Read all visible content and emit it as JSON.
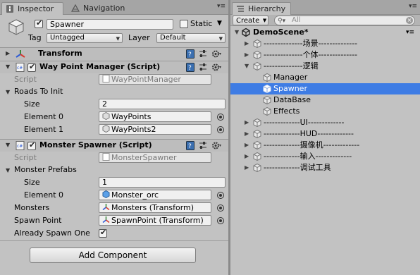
{
  "inspector": {
    "tab_label": "Inspector",
    "nav_tab_label": "Navigation",
    "object_name": "Spawner",
    "static_label": "Static",
    "tag_label": "Tag",
    "tag_value": "Untagged",
    "layer_label": "Layer",
    "layer_value": "Default",
    "transform": {
      "title": "Transform"
    },
    "waypoint_manager": {
      "title": "Way Point Manager (Script)",
      "script_label": "Script",
      "script_value": "WayPointManager",
      "roads_label": "Roads To Init",
      "size_label": "Size",
      "size_value": "2",
      "element0_label": "Element 0",
      "element0_value": "WayPoints",
      "element1_label": "Element 1",
      "element1_value": "WayPoints2"
    },
    "monster_spawner": {
      "title": "Monster Spawner (Script)",
      "script_label": "Script",
      "script_value": "MonsterSpawner",
      "prefabs_label": "Monster Prefabs",
      "size_label": "Size",
      "size_value": "1",
      "element0_label": "Element 0",
      "element0_value": "Monster_orc",
      "monsters_label": "Monsters",
      "monsters_value": "Monsters (Transform)",
      "spawnpoint_label": "Spawn Point",
      "spawnpoint_value": "SpawnPoint (Transform)",
      "already_label": "Already Spawn One"
    },
    "add_component_label": "Add Component"
  },
  "hierarchy": {
    "tab_label": "Hierarchy",
    "create_label": "Create",
    "search_placeholder": "All",
    "scene_name": "DemoScene*",
    "items": [
      {
        "label": "--------------场景--------------"
      },
      {
        "label": "--------------个体--------------"
      },
      {
        "label": "--------------逻辑"
      },
      {
        "label": "Manager"
      },
      {
        "label": "Spawner"
      },
      {
        "label": "DataBase"
      },
      {
        "label": "Effects"
      },
      {
        "label": "-------------UI-------------"
      },
      {
        "label": "-------------HUD-------------"
      },
      {
        "label": "-------------摄像机-------------"
      },
      {
        "label": "-------------输入-------------"
      },
      {
        "label": "-------------调试工具"
      }
    ]
  },
  "colors": {
    "panel_bg": "#c2c2c2",
    "selection": "#3e7ce4",
    "tab_bg": "#a5a5a5"
  }
}
